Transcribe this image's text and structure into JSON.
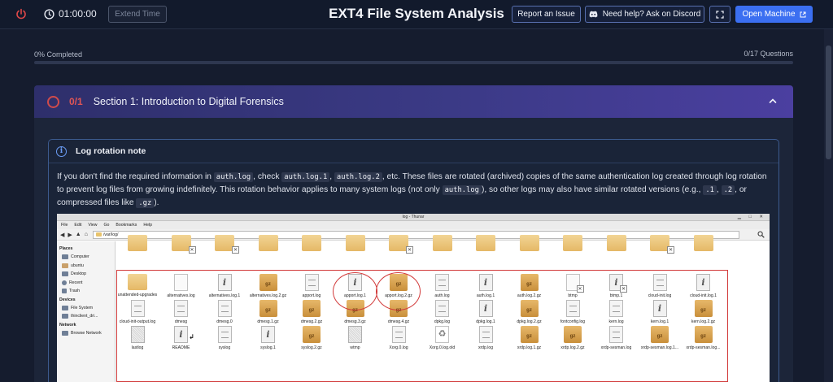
{
  "header": {
    "timer": "01:00:00",
    "extend_label": "Extend Time",
    "title": "EXT4 File System Analysis",
    "report_label": "Report an Issue",
    "discord_label": "Need help? Ask on Discord",
    "open_machine_label": "Open Machine"
  },
  "progress": {
    "completed_label": "0% Completed",
    "questions_label": "0/17 Questions",
    "completed_fraction": 0
  },
  "section": {
    "score": "0/1",
    "title": "Section 1: Introduction to Digital Forensics"
  },
  "note": {
    "title": "Log rotation note",
    "t1": "If you don't find the required information in ",
    "c1": "auth.log",
    "t2": ", check ",
    "c2": "auth.log.1",
    "t3": ", ",
    "c3": "auth.log.2",
    "t4": ", etc. These files are rotated (archived) copies of the same authentication log created through log rotation to prevent log files from growing indefinitely. This rotation behavior applies to many system logs (not only ",
    "c4": "auth.log",
    "t5": "), so other logs may also have similar rotated versions (e.g., ",
    "c5": ".1",
    "t6": ", ",
    "c6": ".2",
    "t7": ", or compressed files like ",
    "c7": ".gz",
    "t8": ")."
  },
  "screenshot": {
    "window_title": "log - Thunar",
    "menu": [
      "File",
      "Edit",
      "View",
      "Go",
      "Bookmarks",
      "Help"
    ],
    "path": "/var/log/",
    "places_head": "Places",
    "places": [
      "Computer",
      "ubuntu",
      "Desktop",
      "Recent",
      "Trash"
    ],
    "devices_head": "Devices",
    "devices": [
      "File System",
      "thinclient_dri..."
    ],
    "network_head": "Network",
    "network": [
      "Browse Network"
    ],
    "files": [
      {
        "name": "unattended-upgrades",
        "type": "folder"
      },
      {
        "name": "alternatives.log",
        "type": "blank"
      },
      {
        "name": "alternatives.log.1",
        "type": "info"
      },
      {
        "name": "alternatives.log.2.gz",
        "type": "gz"
      },
      {
        "name": "apport.log",
        "type": "text"
      },
      {
        "name": "apport.log.1",
        "type": "info"
      },
      {
        "name": "apport.log.2.gz",
        "type": "gz"
      },
      {
        "name": "auth.log",
        "type": "text"
      },
      {
        "name": "auth.log.1",
        "type": "info"
      },
      {
        "name": "auth.log.2.gz",
        "type": "gz"
      },
      {
        "name": "btmp",
        "type": "blank",
        "badge": "x"
      },
      {
        "name": "btmp.1",
        "type": "info",
        "badge": "x"
      },
      {
        "name": "cloud-init.log",
        "type": "text"
      },
      {
        "name": "cloud-init.log.1",
        "type": "info"
      },
      {
        "name": "cloud-init-output.log",
        "type": "text"
      },
      {
        "name": "dmesg",
        "type": "text"
      },
      {
        "name": "dmesg.0",
        "type": "text"
      },
      {
        "name": "dmesg.1.gz",
        "type": "gz"
      },
      {
        "name": "dmesg.2.gz",
        "type": "gz"
      },
      {
        "name": "dmesg.3.gz",
        "type": "gz"
      },
      {
        "name": "dmesg.4.gz",
        "type": "gz"
      },
      {
        "name": "dpkg.log",
        "type": "text"
      },
      {
        "name": "dpkg.log.1",
        "type": "info"
      },
      {
        "name": "dpkg.log.2.gz",
        "type": "gz"
      },
      {
        "name": "fontconfig.log",
        "type": "text"
      },
      {
        "name": "kern.log",
        "type": "text"
      },
      {
        "name": "kern.log.1",
        "type": "info"
      },
      {
        "name": "kern.log.2.gz",
        "type": "gz"
      },
      {
        "name": "lastlog",
        "type": "bin"
      },
      {
        "name": "README",
        "type": "info",
        "badge": "link"
      },
      {
        "name": "syslog",
        "type": "text"
      },
      {
        "name": "syslog.1",
        "type": "info"
      },
      {
        "name": "syslog.2.gz",
        "type": "gz"
      },
      {
        "name": "wtmp",
        "type": "bin"
      },
      {
        "name": "Xorg.0.log",
        "type": "text"
      },
      {
        "name": "Xorg.0.log.old",
        "type": "recycle"
      },
      {
        "name": "xrdp.log",
        "type": "text"
      },
      {
        "name": "xrdp.log.1.gz",
        "type": "gz"
      },
      {
        "name": "xrdp.log.2.gz",
        "type": "gz"
      },
      {
        "name": "xrdp-sesman.log",
        "type": "text"
      },
      {
        "name": "xrdp-sesman.log.1...",
        "type": "gz"
      },
      {
        "name": "xrdp-sesman.log...",
        "type": "gz"
      }
    ]
  },
  "colors": {
    "accent": "#3b6ff1",
    "danger": "#d23b3b",
    "background": "#151c2e"
  }
}
